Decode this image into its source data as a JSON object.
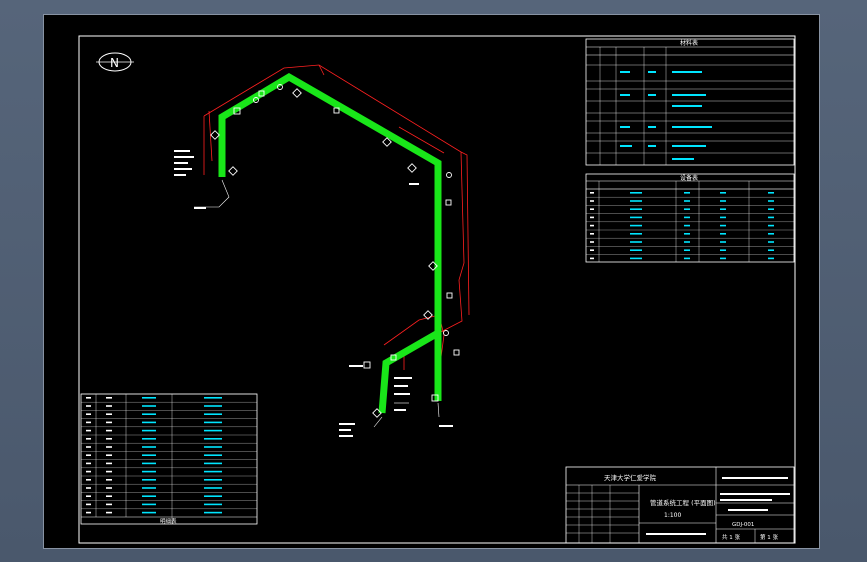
{
  "north_label": "N",
  "title_block": {
    "school": "天津大学仁爱学院",
    "drawing_title": "管道系统工程 (平面图)",
    "scale_note": "1:100",
    "sheet_count": "共 1 张",
    "sheet_index": "第 1 张",
    "drawing_no": "GDJ-001"
  },
  "equipment_table": {
    "heading": "材料表"
  },
  "legend_table": {
    "heading": "设备表"
  },
  "parts_table": {
    "footer": "明细表"
  },
  "colors": {
    "pipe": "#19e619",
    "frame": "#ffffff",
    "dim": "#ff2020",
    "text_cyan": "#00e5ff"
  }
}
